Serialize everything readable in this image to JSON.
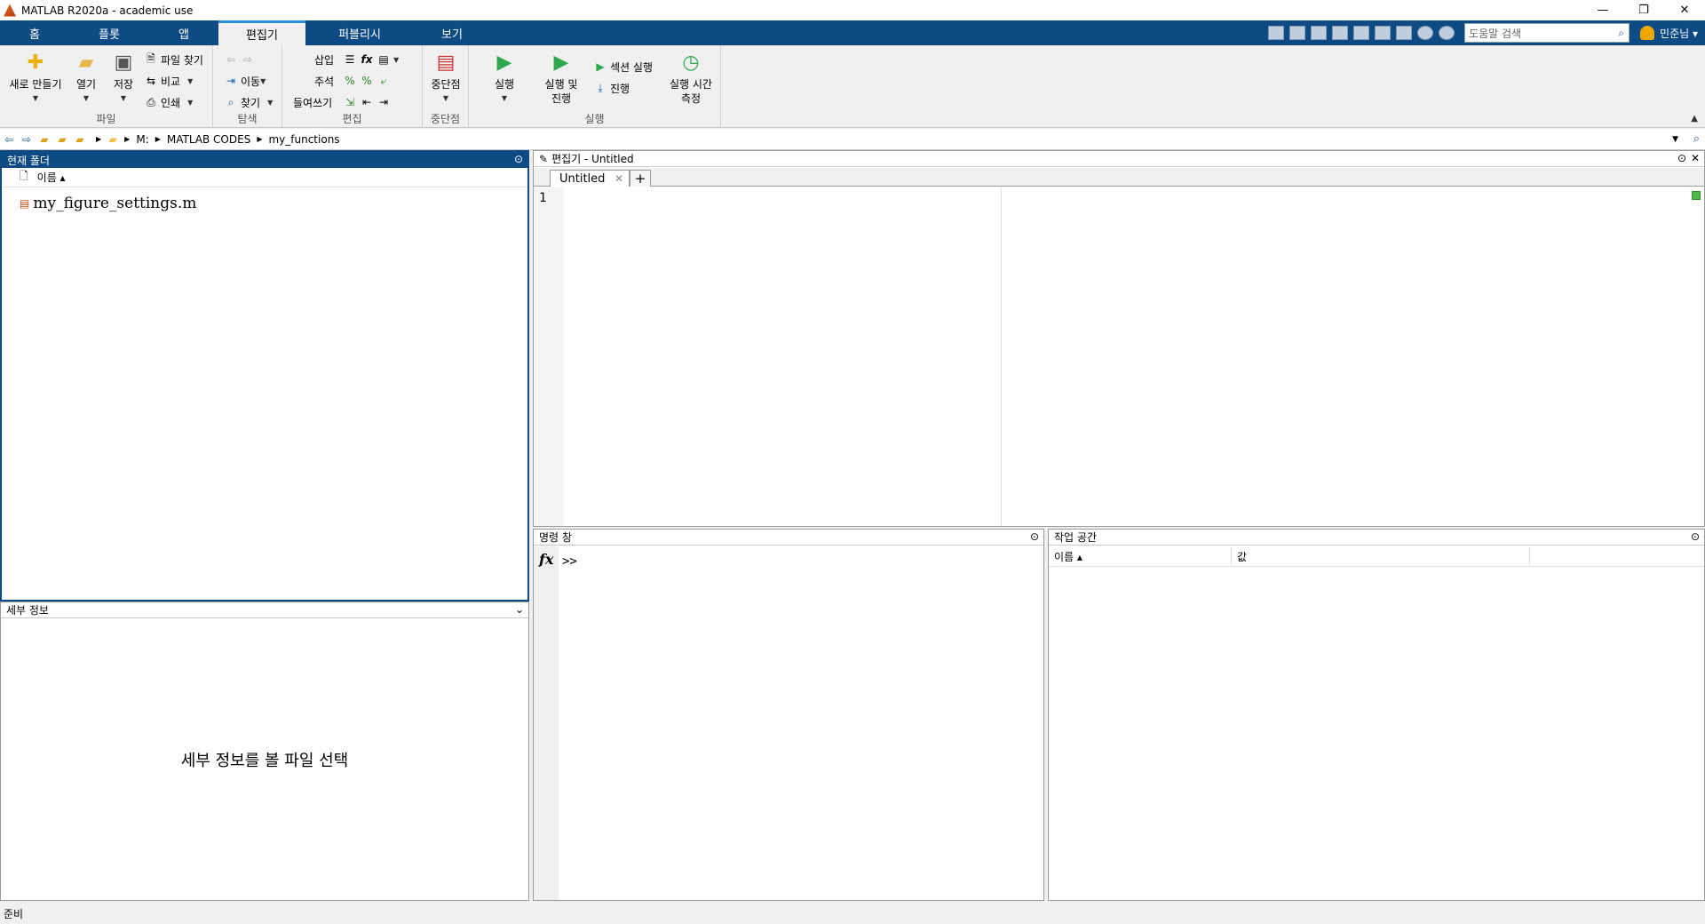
{
  "window": {
    "title": "MATLAB R2020a - academic use",
    "controls": [
      "—",
      "❐",
      "✕"
    ]
  },
  "tabs": [
    {
      "label": "홈"
    },
    {
      "label": "플롯"
    },
    {
      "label": "앱"
    },
    {
      "label": "편집기"
    },
    {
      "label": "퍼블리시"
    },
    {
      "label": "보기"
    }
  ],
  "qat": {
    "search_placeholder": "도움말 검색",
    "user": "민준님 ▾"
  },
  "ribbon": {
    "file": {
      "label": "파일",
      "new": "새로 만들기",
      "open": "열기",
      "save": "저장",
      "find_files": "파일 찾기",
      "compare": "비교",
      "print": "인쇄"
    },
    "navigate": {
      "label": "탐색",
      "goto": "이동",
      "find": "찾기"
    },
    "edit": {
      "label": "편집",
      "insert": "삽입",
      "comment": "주석",
      "indent": "들여쓰기"
    },
    "breakpoints": {
      "label": "중단점",
      "btn": "중단점"
    },
    "run": {
      "label": "실행",
      "run": "실행",
      "run_advance_1": "실행 및",
      "run_advance_2": "진행",
      "run_section": "섹션 실행",
      "advance": "진행",
      "run_time_1": "실행 시간",
      "run_time_2": "측정"
    }
  },
  "address": {
    "crumbs": [
      "M:",
      "MATLAB CODES",
      "my_functions"
    ]
  },
  "current_folder": {
    "title": "현재 폴더",
    "column_name": "이름 ▴",
    "files": [
      "my_figure_settings.m"
    ]
  },
  "details": {
    "title": "세부 정보",
    "message": "세부 정보를 볼 파일 선택"
  },
  "editor": {
    "title": "편집기 - Untitled",
    "tab": "Untitled",
    "line_number": "1"
  },
  "command_window": {
    "title": "명령 창",
    "fx": "fx",
    "prompt": ">>"
  },
  "workspace": {
    "title": "작업 공간",
    "col_name": "이름 ▴",
    "col_value": "값"
  },
  "status": {
    "text": "준비"
  }
}
